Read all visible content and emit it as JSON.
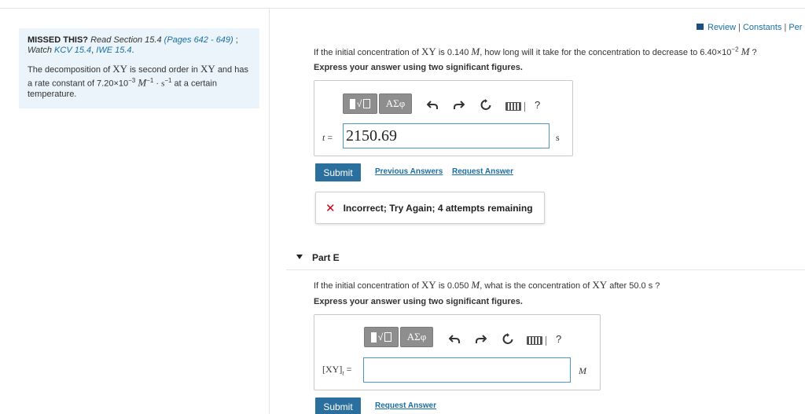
{
  "missed": {
    "label": "MISSED THIS?",
    "read": "Read Section 15.4",
    "pages": "(Pages 642 - 649)",
    "semicolon": " ;",
    "watch": "Watch",
    "kcv": "KCV 15.4",
    "comma": ",",
    "iwe": "IWE 15.4",
    "period": ".",
    "problem_line1": "The decomposition of",
    "xy": "XY",
    "problem_line2": "is second order in",
    "problem_line3": "and has a rate constant of 7.20×10",
    "exp": "−3",
    "units": "M",
    "unit_sup1": "−1",
    "dot": "·",
    "s": "s",
    "unit_sup2": "−1",
    "problem_end": "at a certain temperature."
  },
  "toplinks": {
    "review": "Review",
    "sep": "|",
    "constants": "Constants",
    "periodic": "Per"
  },
  "partd": {
    "q_pre": "If the initial concentration of",
    "xy": "XY",
    "q_is": "is 0.140",
    "m": "M",
    "q_post": ", how long will it take for the concentration to decrease to 6.40×10",
    "q_exp": "−2",
    "q_m2": "M",
    "q_end": "?",
    "express": "Express your answer using two significant figures.",
    "var": "t",
    "eq": "=",
    "value": "2150.69",
    "unit": "s",
    "submit": "Submit",
    "prev": "Previous Answers",
    "request": "Request Answer",
    "feedback": "Incorrect; Try Again; 4 attempts remaining"
  },
  "toolbar": {
    "templates": "√",
    "symbols": "ΑΣφ",
    "help": "?"
  },
  "parte": {
    "title": "Part E",
    "q_pre": "If the initial concentration of",
    "xy": "XY",
    "q_is": "is 0.050",
    "m": "M",
    "q_mid": ", what is the concentration of",
    "xy2": "XY",
    "q_post": "after 50.0 s ?",
    "express": "Express your answer using two significant figures.",
    "var_label": "[XY]",
    "var_sub": "t",
    "eq": "=",
    "value": "",
    "unit": "M",
    "submit": "Submit",
    "request": "Request Answer"
  },
  "colors": {
    "accent": "#2b6f9e",
    "link": "#1a6fa3",
    "error": "#d0021b",
    "hint_bg": "#eaf4fa"
  },
  "icons": [
    "undo-icon",
    "redo-icon",
    "reset-icon",
    "keyboard-icon",
    "help-icon",
    "incorrect-x-icon",
    "collapse-triangle-icon"
  ]
}
